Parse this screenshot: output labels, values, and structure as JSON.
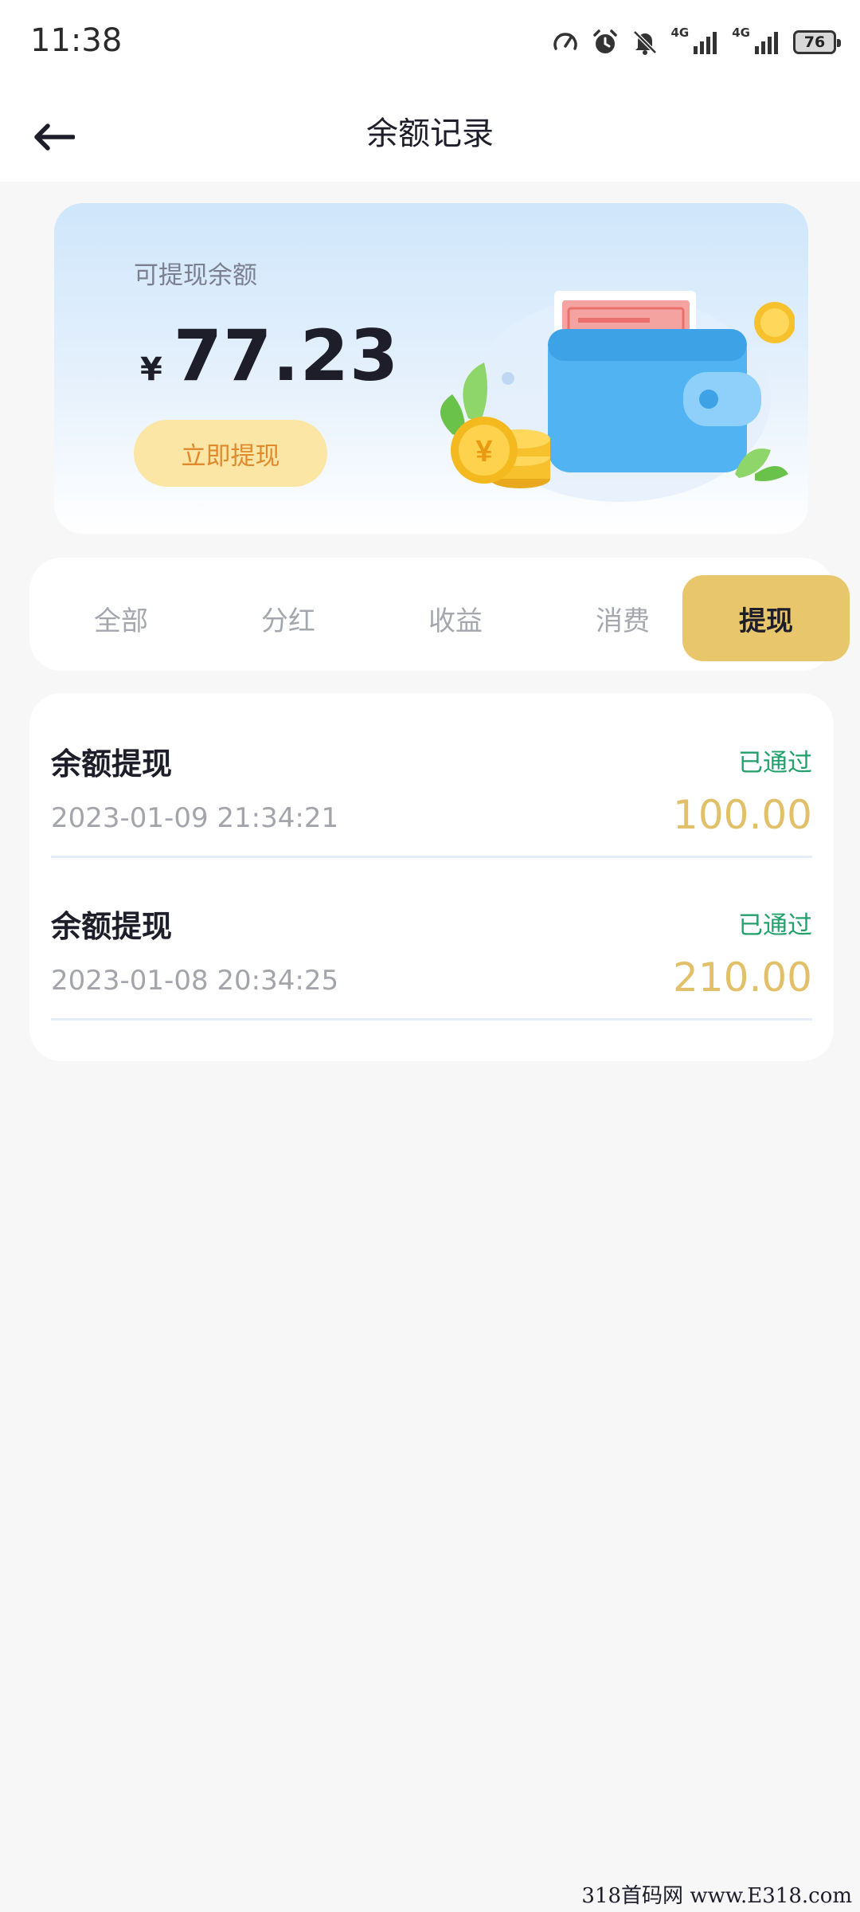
{
  "status_bar": {
    "time": "11:38",
    "network_1": "4G",
    "network_2": "4G",
    "battery": "76",
    "icons": [
      "speed-icon",
      "alarm-icon",
      "bell-off-icon",
      "signal-icon",
      "signal-icon",
      "battery-icon"
    ]
  },
  "nav": {
    "back_icon": "arrow-left-icon",
    "title": "余额记录"
  },
  "balance": {
    "label": "可提现余额",
    "currency": "¥",
    "amount": "77.23",
    "withdraw_button": "立即提现",
    "illustration": "wallet-with-coins-and-banknotes"
  },
  "tabs": [
    {
      "label": "全部",
      "active": false
    },
    {
      "label": "分红",
      "active": false
    },
    {
      "label": "收益",
      "active": false
    },
    {
      "label": "消费",
      "active": false
    },
    {
      "label": "提现",
      "active": true
    }
  ],
  "records": [
    {
      "title": "余额提现",
      "status": "已通过",
      "time": "2023-01-09 21:34:21",
      "amount": "100.00"
    },
    {
      "title": "余额提现",
      "status": "已通过",
      "time": "2023-01-08 20:34:25",
      "amount": "210.00"
    }
  ],
  "watermark": "318首码网 www.E318.com",
  "colors": {
    "accent_gold": "#e8c66c",
    "amount_gold": "#e2c06a",
    "status_green": "#22a06b",
    "button_bg": "#fbe6a6",
    "button_text": "#e08a2c"
  }
}
